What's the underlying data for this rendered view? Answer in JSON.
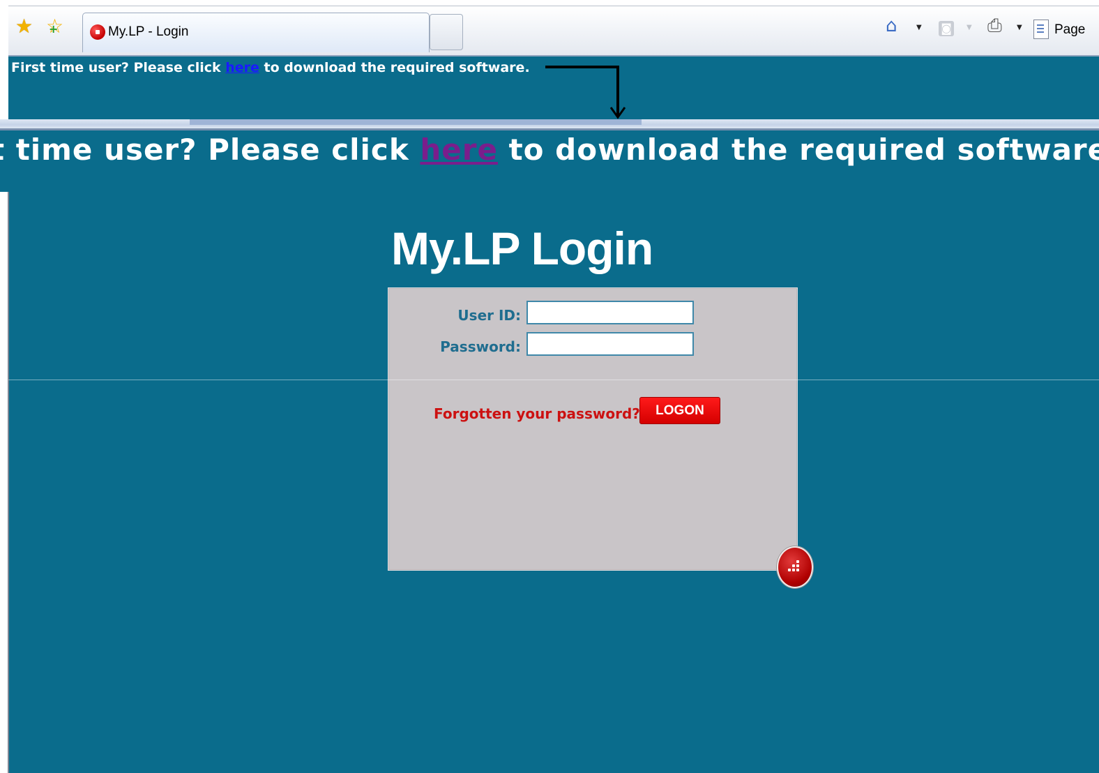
{
  "browser": {
    "tab_title": "My.LP - Login",
    "page_menu_label": "Page"
  },
  "notice": {
    "prefix": "First time user? Please click ",
    "link_text": "here",
    "suffix": " to download the required software."
  },
  "zoomed_notice": {
    "prefix": "t time user? Please click ",
    "link_text": "here",
    "suffix": " to download the required software."
  },
  "login": {
    "title": "My.LP Login",
    "user_id_label": "User ID:",
    "user_id_value": "",
    "password_label": "Password:",
    "password_value": "",
    "forgot_link": "Forgotten your password?",
    "logon_button": "LOGON"
  },
  "icons": {
    "favorites": "star-icon",
    "add_favorites": "add-favorites-icon",
    "home": "home-icon",
    "feeds": "rss-icon",
    "print": "print-icon",
    "page": "page-icon",
    "brand": "lp-logo-icon"
  },
  "colors": {
    "page_background": "#0a6c8c",
    "login_panel": "#c9c5c8",
    "accent_red": "#d40000",
    "label_blue": "#1f6d8f"
  }
}
